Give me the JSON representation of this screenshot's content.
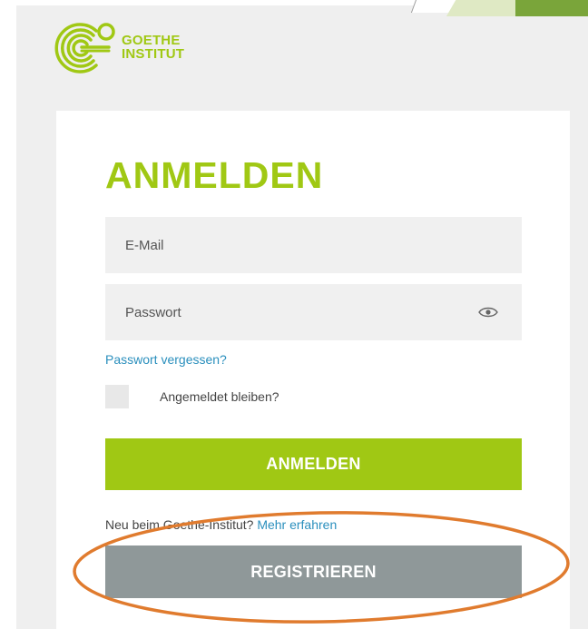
{
  "brand": {
    "line1": "GOETHE",
    "line2": "INSTITUT",
    "color": "#a0c814"
  },
  "login": {
    "title": "ANMELDEN",
    "email_placeholder": "E-Mail",
    "password_placeholder": "Passwort",
    "forgot_link": "Passwort vergessen?",
    "remember_label": "Angemeldet bleiben?",
    "submit_label": "ANMELDEN"
  },
  "register": {
    "prompt": "Neu beim Goethe-Institut?",
    "more_link": "Mehr erfahren",
    "button_label": "REGISTRIEREN"
  },
  "icons": {
    "password_toggle": "eye-icon"
  },
  "colors": {
    "accent_green": "#a0c814",
    "link_blue": "#2a8fbd",
    "register_gray": "#8f9899",
    "annotation_orange": "#e07b2e"
  }
}
